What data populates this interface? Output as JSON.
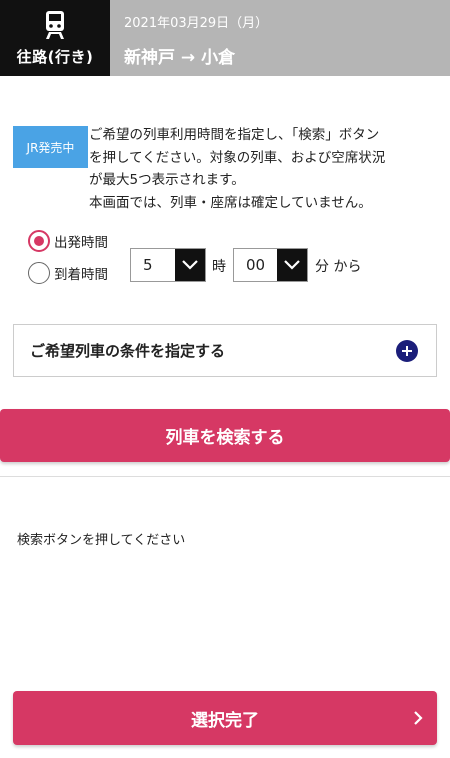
{
  "header": {
    "leg_label": "往路(行き)",
    "leg_icon": "train-icon",
    "date": "2021年03月29日（月）",
    "route": "新神戸 → 小倉"
  },
  "badge": {
    "label": "JR発売中",
    "color": "#4aa3e5"
  },
  "notice": {
    "lines": [
      "ご希望の列車利用時間を指定し、「検索」ボタン",
      "を押してください。対象の列車、および空席状況",
      "が最大5つ表示されます。",
      "本画面では、列車・座席は確定していません。"
    ]
  },
  "time_type": {
    "options": [
      {
        "label": "出発時間",
        "checked": true
      },
      {
        "label": "到着時間",
        "checked": false
      }
    ]
  },
  "time_select": {
    "hour": "5",
    "hour_unit": "時",
    "minute": "00",
    "minute_unit": "分 から"
  },
  "conditions": {
    "label": "ご希望列車の条件を指定する",
    "icon": "plus-icon"
  },
  "search_button": {
    "label": "列車を検索する"
  },
  "result": {
    "message": "検索ボタンを押してください"
  },
  "done_button": {
    "label": "選択完了",
    "icon": "chevron-right-icon"
  },
  "colors": {
    "accent": "#d63864",
    "header_gray": "#b5b5b5",
    "plus_navy": "#1b1e7a",
    "dark": "#111111"
  }
}
